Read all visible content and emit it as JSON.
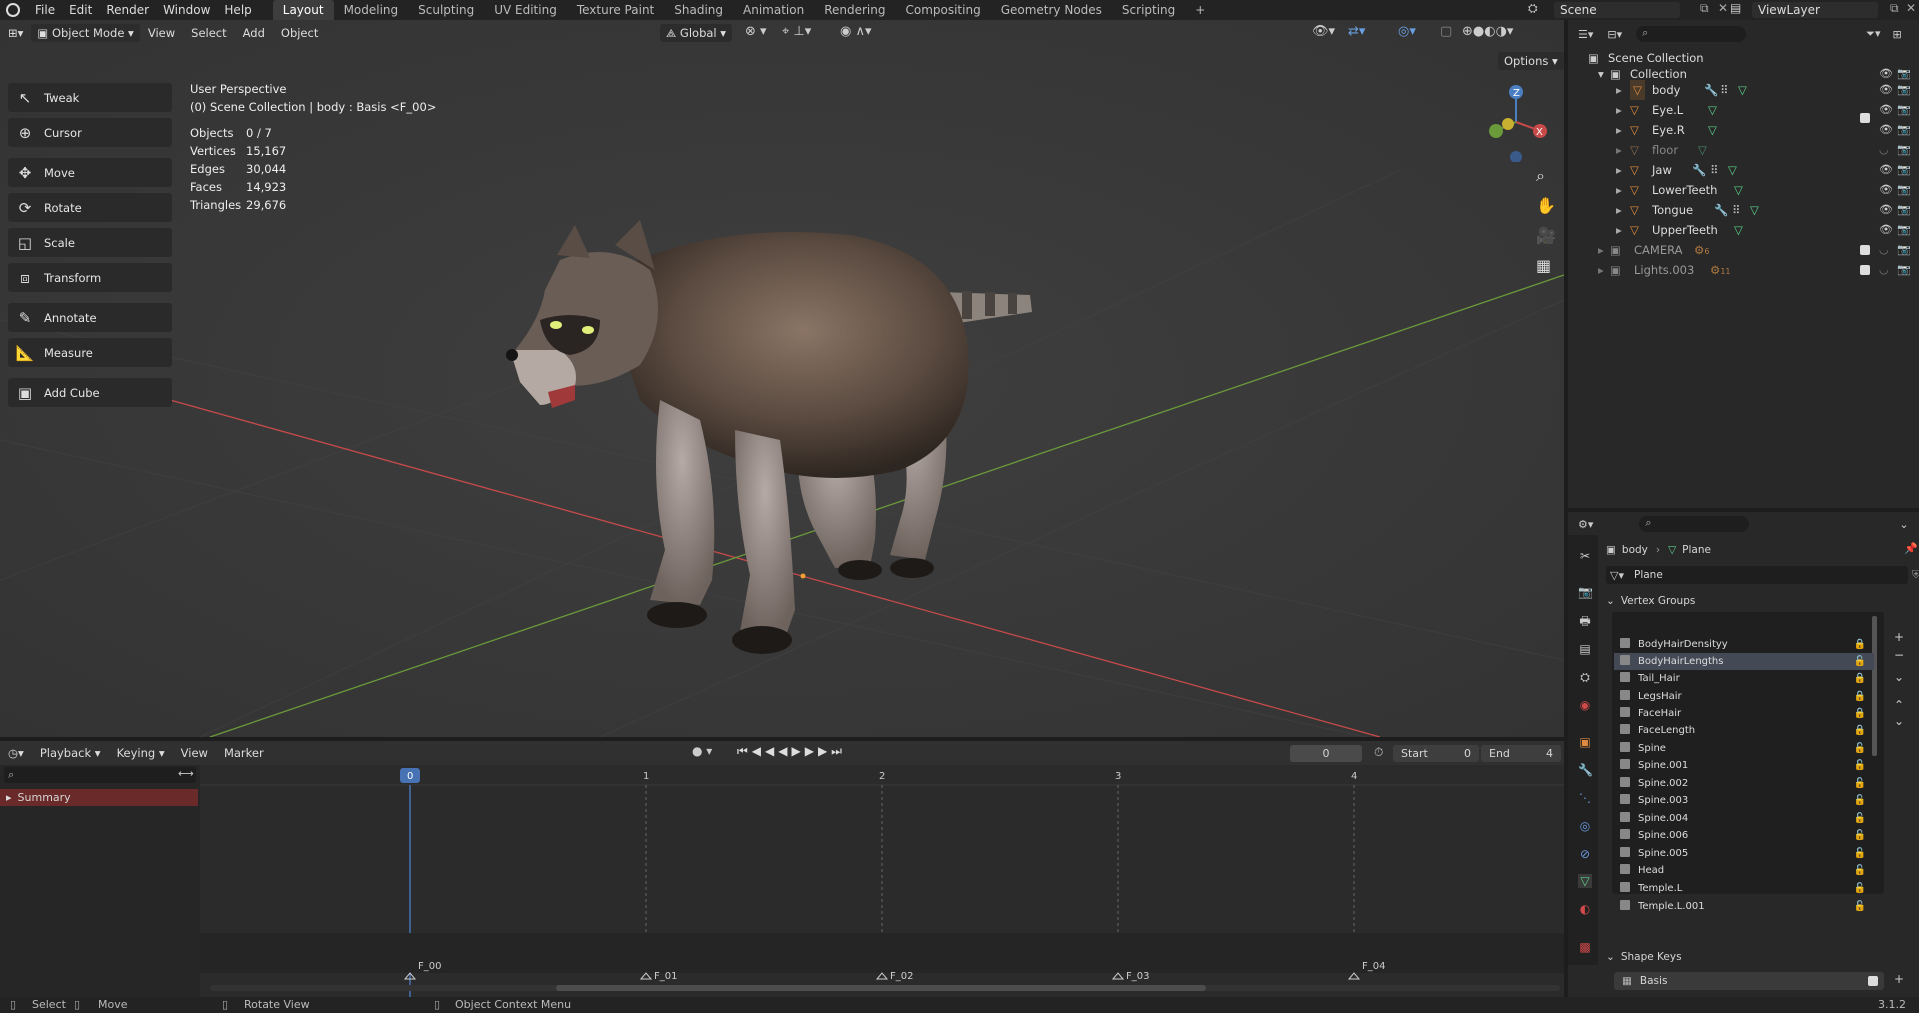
{
  "topbar": {
    "menus": [
      "File",
      "Edit",
      "Render",
      "Window",
      "Help"
    ],
    "workspaces": [
      "Layout",
      "Modeling",
      "Sculpting",
      "UV Editing",
      "Texture Paint",
      "Shading",
      "Animation",
      "Rendering",
      "Compositing",
      "Geometry Nodes",
      "Scripting"
    ],
    "active_workspace": "Layout",
    "add_tab": "+",
    "scene": "Scene",
    "view_layer": "ViewLayer"
  },
  "viewport": {
    "mode": "Object Mode",
    "menus": [
      "View",
      "Select",
      "Add",
      "Object"
    ],
    "orientation": "Global",
    "options": "Options",
    "perspective": "User Perspective",
    "context": "(0) Scene Collection | body : Basis <F_00>",
    "stats": [
      {
        "label": "Objects",
        "value": "0 / 7"
      },
      {
        "label": "Vertices",
        "value": "15,167"
      },
      {
        "label": "Edges",
        "value": "30,044"
      },
      {
        "label": "Faces",
        "value": "14,923"
      },
      {
        "label": "Triangles",
        "value": "29,676"
      }
    ],
    "tools": [
      "Tweak",
      "Cursor",
      "Move",
      "Rotate",
      "Scale",
      "Transform",
      "Annotate",
      "Measure",
      "Add Cube"
    ],
    "gizmo": {
      "z": "Z",
      "x": "X",
      "y": "Y"
    }
  },
  "outliner": {
    "root": "Scene Collection",
    "collection": "Collection",
    "objects": [
      {
        "name": "body",
        "extra": "6"
      },
      {
        "name": "Eye.L"
      },
      {
        "name": "Eye.R"
      },
      {
        "name": "floor"
      },
      {
        "name": "Jaw"
      },
      {
        "name": "LowerTeeth"
      },
      {
        "name": "Tongue"
      },
      {
        "name": "UpperTeeth"
      }
    ],
    "collections": [
      {
        "name": "CAMERA",
        "badge": "6"
      },
      {
        "name": "Lights.003",
        "badge": "11"
      }
    ]
  },
  "properties": {
    "breadcrumb_object": "body",
    "breadcrumb_data": "Plane",
    "mesh_name": "Plane",
    "vertex_groups_title": "Vertex Groups",
    "vertex_groups": [
      "BodyHairDensityy",
      "BodyHairLengths",
      "Tail_Hair",
      "LegsHair",
      "FaceHair",
      "FaceLength",
      "Spine",
      "Spine.001",
      "Spine.002",
      "Spine.003",
      "Spine.004",
      "Spine.006",
      "Spine.005",
      "Head",
      "Temple.L",
      "Temple.L.001"
    ],
    "active_vertex_group": "BodyHairLengths",
    "shape_keys_title": "Shape Keys",
    "shape_key": "Basis"
  },
  "timeline": {
    "menus": [
      "Playback",
      "Keying",
      "View",
      "Marker"
    ],
    "current_frame": "0",
    "start_label": "Start",
    "start": "0",
    "end_label": "End",
    "end": "4",
    "summary": "Summary",
    "frames": [
      "0",
      "1",
      "2",
      "3",
      "4"
    ],
    "markers": [
      "F_00",
      "F_01",
      "F_02",
      "F_03",
      "F_04"
    ]
  },
  "status": {
    "select": "Select",
    "move": "Move",
    "rotate": "Rotate View",
    "context": "Object Context Menu",
    "version": "3.1.2"
  },
  "colors": {
    "accent": "#4772b3",
    "mesh_orange": "#e08a3e",
    "data_green": "#5bd18a",
    "x_axis": "#c84a4a",
    "y_axis": "#6a9a3a",
    "timeline_summary": "#6a2a2a"
  }
}
